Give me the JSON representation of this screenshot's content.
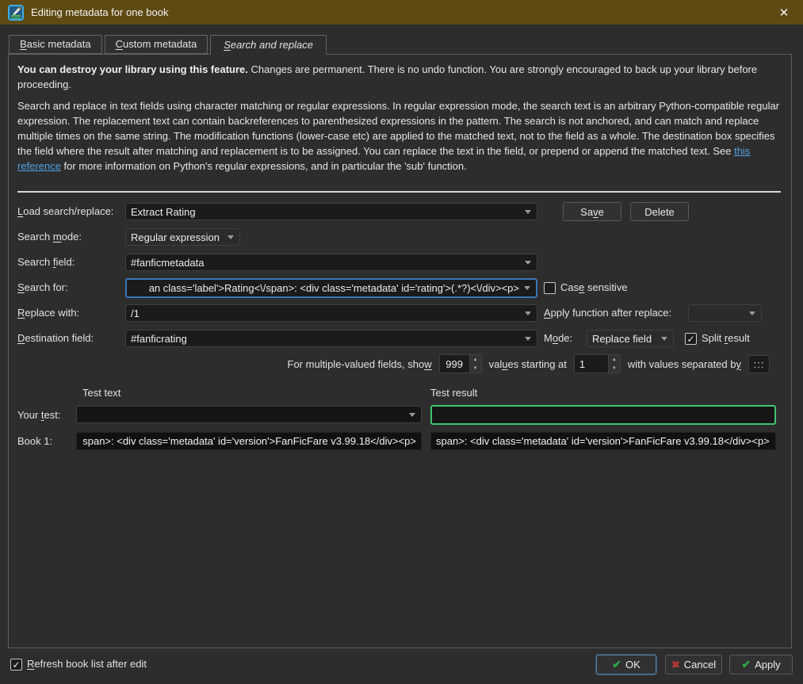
{
  "window": {
    "title": "Editing metadata for one book"
  },
  "icons": {
    "close": "✕",
    "ok_check": "✔",
    "cancel_x": "✖",
    "apply_check": "✔",
    "checkmark": "✓",
    "spin_up": "▲",
    "spin_down": "▼"
  },
  "colors": {
    "titlebar": "#5e4a12",
    "focus-border": "#3a76b8",
    "result-border": "#3fc56f",
    "link": "#53a1e4",
    "ok-border": "#5381ad",
    "green-check": "#2ea84c",
    "red-x": "#b03434"
  },
  "tabs": [
    {
      "label": "&Basic metadata",
      "active": false
    },
    {
      "label": "&Custom metadata",
      "active": false
    },
    {
      "label": "&Search and replace",
      "active": true
    }
  ],
  "warning": {
    "bold": "You can destroy your library using this feature.",
    "rest": " Changes are permanent. There is no undo function. You are strongly encouraged to back up your library before proceeding."
  },
  "description": {
    "before_link": "Search and replace in text fields using character matching or regular expressions. In regular expression mode, the search text is an arbitrary Python-compatible regular expression. The replacement text can contain backreferences to parenthesized expressions in the pattern. The search is not anchored, and can match and replace multiple times on the same string. The modification functions (lower-case etc) are applied to the matched text, not to the field as a whole. The destination box specifies the field where the result after matching and replacement is to be assigned. You can replace the text in the field, or prepend or append the matched text. See ",
    "link": "this reference",
    "after_link": " for more information on Python's regular expressions, and in particular the 'sub' function."
  },
  "form": {
    "load_label": "&Load search/replace:",
    "load_value": "Extract Rating",
    "save_button": "Sa&ve",
    "delete_button": "Delete",
    "search_mode_label": "Search &mode:",
    "search_mode_value": "Regular expression",
    "search_field_label": "Search &field:",
    "search_field_value": "#fanficmetadata",
    "search_for_label": "&Search for:",
    "search_for_value": "an class='label'>Rating<\\/span>: <div class='metadata' id='rating'>(.*?)<\\/div><p>",
    "case_sensitive_label": "Cas&e sensitive",
    "case_sensitive_checked": false,
    "replace_with_label": "&Replace with:",
    "replace_with_value": "/1",
    "apply_function_label": "&Apply function after replace:",
    "apply_function_value": "",
    "destination_label": "&Destination field:",
    "destination_value": "#fanficrating",
    "mode_label": "M&ode:",
    "mode_value": "Replace field",
    "split_result_label": "Split &result",
    "split_result_checked": true,
    "multi_text_1": "For multiple-valued fields, sho&w",
    "show_value": "999",
    "multi_text_2": "val&ues starting at",
    "start_value": "1",
    "multi_text_3": "with values separated b&y",
    "separator_value": ":::"
  },
  "test": {
    "text_header": "Test text",
    "result_header": "Test result",
    "your_test_label": "Your &test:",
    "your_test_value": "",
    "your_test_result": "",
    "book1_label": "Book 1:",
    "book1_text": "span>: <div class='metadata' id='version'>FanFicFare v3.99.18</div><p>",
    "book1_result": "span>: <div class='metadata' id='version'>FanFicFare v3.99.18</div><p>"
  },
  "footer": {
    "refresh_label": "&Refresh book list after edit",
    "refresh_checked": true,
    "ok": "OK",
    "cancel": "Cancel",
    "apply": "Apply"
  }
}
